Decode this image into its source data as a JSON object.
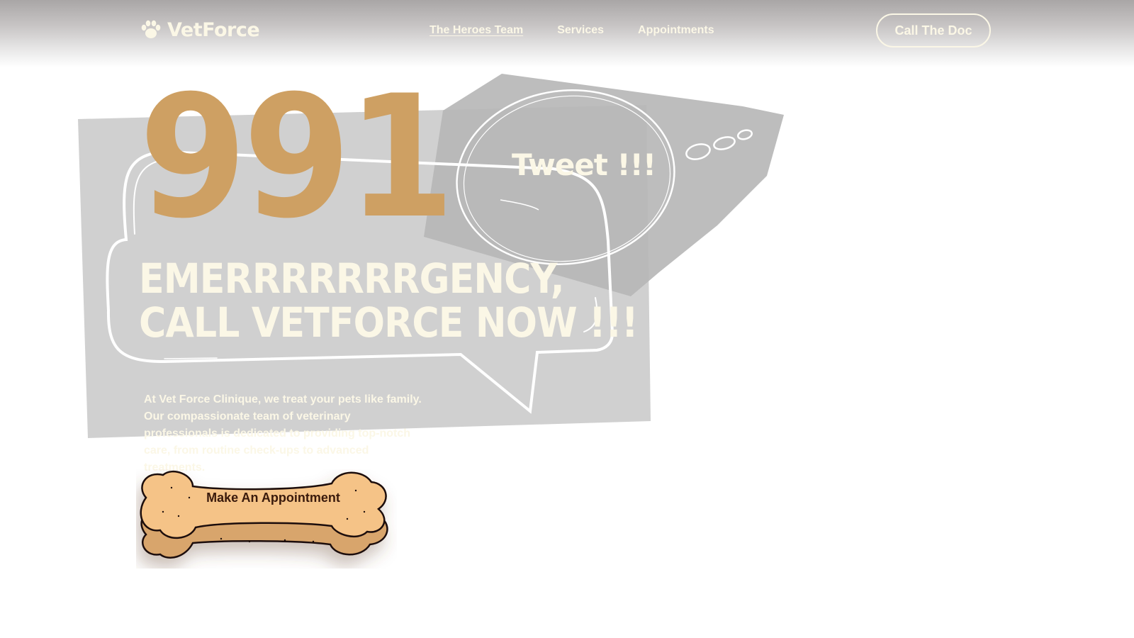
{
  "header": {
    "logo_text": "VetForce",
    "nav": [
      {
        "label": "The Heroes Team",
        "active": true
      },
      {
        "label": "Services",
        "active": false
      },
      {
        "label": "Appointments",
        "active": false
      }
    ],
    "cta_label": "Call The Doc"
  },
  "hero": {
    "number": "991",
    "tweet": "Tweet !!!",
    "headline_line1": "EMERRRRRRRGENCY,",
    "headline_line2": "CALL VETFORCE NOW !!!",
    "description": "At Vet Force Clinique, we treat your pets like family. Our compassionate team of veterinary professionals is dedicated to providing top-notch care, from routine check-ups to advanced treatments.",
    "button_label": "Make An Appointment"
  },
  "colors": {
    "cream": "#fbf7e6",
    "tan": "#cea063",
    "bone": "#f5c387",
    "bone_text": "#3a1a0c",
    "panel_gray": "#d0d0d0",
    "panel_dark": "#bdbdbd"
  },
  "icons": {
    "logo": "paw-icon",
    "bubble": "speech-bubble",
    "thought": "thought-bubble",
    "button": "dog-bone"
  }
}
